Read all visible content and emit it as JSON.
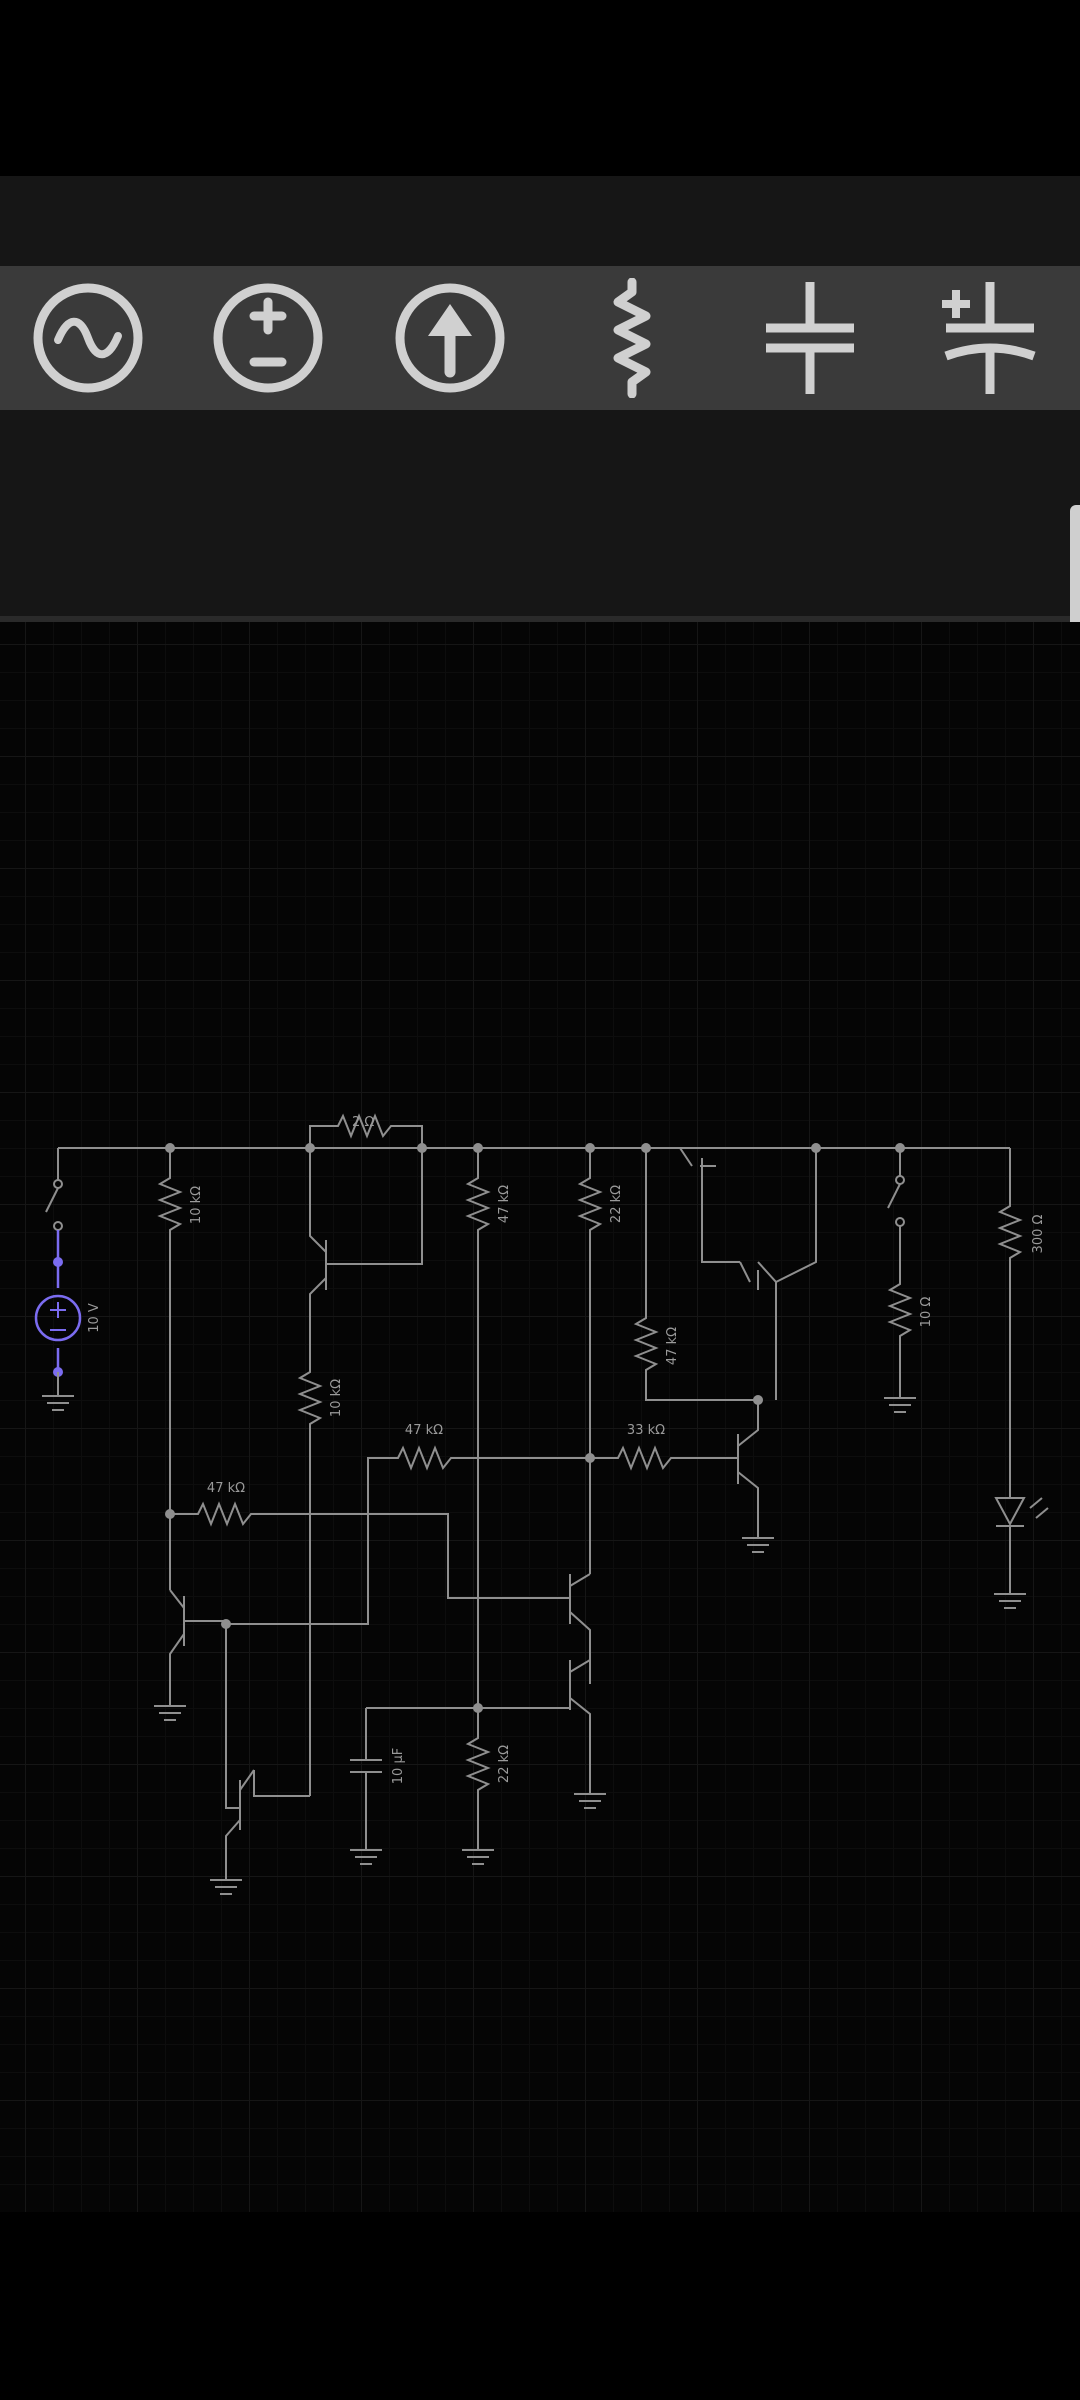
{
  "toolbar": {
    "tools": [
      {
        "name": "ac-source-icon"
      },
      {
        "name": "dc-voltage-source-icon"
      },
      {
        "name": "current-source-icon"
      },
      {
        "name": "resistor-icon"
      },
      {
        "name": "capacitor-icon"
      },
      {
        "name": "polarized-capacitor-icon"
      }
    ]
  },
  "circuit": {
    "source_label": "10 V",
    "labels": {
      "r_top_2ohm": "2 Ω",
      "r_10k_left": "10 kΩ",
      "r_10k_mid": "10 kΩ",
      "r_47k_a": "47 kΩ",
      "r_22k_a": "22 kΩ",
      "r_47k_b": "47 kΩ",
      "r_47k_h1": "47 kΩ",
      "r_47k_h2": "47 kΩ",
      "r_33k": "33 kΩ",
      "r_10ohm": "10 Ω",
      "r_300ohm": "300 Ω",
      "r_22k_b": "22 kΩ",
      "c_10uf": "10 µF"
    }
  },
  "colors": {
    "background": "#050505",
    "wire": "#8f8f8f",
    "selected": "#7b6cf0",
    "toolbar": "#3a3a3a"
  }
}
